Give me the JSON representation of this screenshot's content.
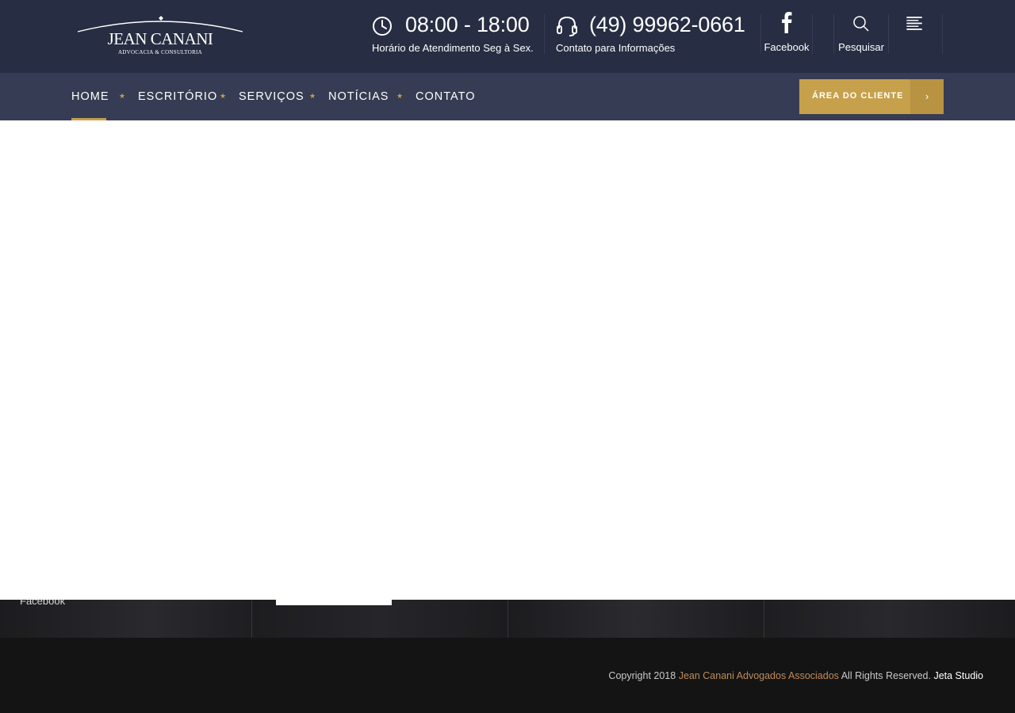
{
  "logo": {
    "name": "JEAN CANANI",
    "tagline": "ADVOCACIA & CONSULTORIA"
  },
  "header": {
    "hours": {
      "icon": "clock-icon",
      "value": "08:00 - 18:00",
      "caption": "Horário de Atendimento Seg à Sex."
    },
    "phone": {
      "icon": "headset-icon",
      "value": "(49) 99962-0661",
      "caption": "Contato para Informações"
    },
    "facebook_label": "Facebook",
    "search_label": "Pesquisar"
  },
  "nav": {
    "items": [
      {
        "label": "HOME",
        "active": true
      },
      {
        "label": "ESCRITÓRIO"
      },
      {
        "label": "SERVIÇOS"
      },
      {
        "label": "NOTÍCIAS"
      },
      {
        "label": "CONTATO"
      }
    ],
    "separator": "★",
    "cta_label": "ÁREA DO CLIENTE",
    "cta_arrow": "›"
  },
  "band": {
    "partial_text": "Facebook"
  },
  "footer": {
    "copyright_prefix": "Copyright 2018",
    "company": "Jean Canani Advogados Associados",
    "rights": "All Rights Reserved.",
    "studio": "Jeta Studio"
  },
  "colors": {
    "header_bg": "#272d42",
    "nav_bg": "#363c53",
    "accent_gold": "#c6a04a",
    "footer_bg": "#141414",
    "link_copper": "#c08a5a"
  }
}
